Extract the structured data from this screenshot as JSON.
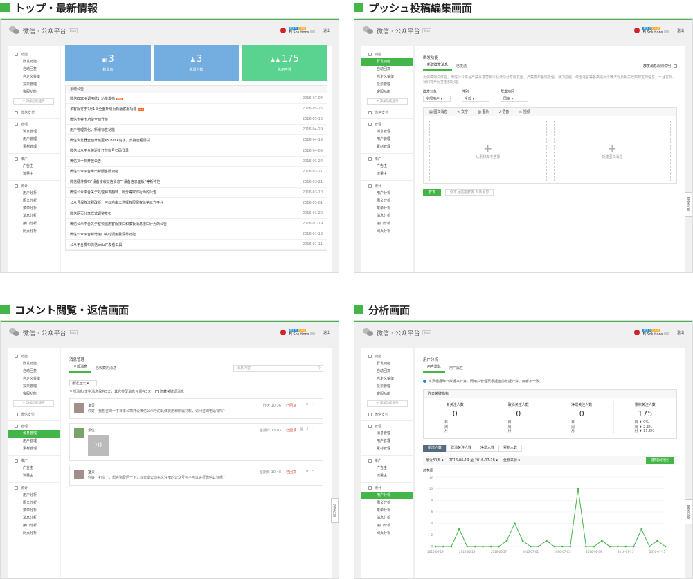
{
  "quads": {
    "q1": {
      "title": "トップ・最新情報"
    },
    "q2": {
      "title": "プッシュ投稿編集画面"
    },
    "q3": {
      "title": "コメント閲覧・返信画面"
    },
    "q4": {
      "title": "分析画面"
    }
  },
  "app": {
    "name": "微信 · 公众平台",
    "beta": "Beta",
    "account": "FJ Solutions",
    "badge_verified": "服务号",
    "badge_auth": "已认证",
    "logout": "退出",
    "feedback": "常见问题"
  },
  "sidebar": {
    "func_group": "功能",
    "func_items": [
      "群发功能",
      "自动回复",
      "自定义菜单",
      "投票管理",
      "客服功能"
    ],
    "add_plugin": "+ 添加功能插件",
    "pay": "微信支付",
    "manage_group": "管理",
    "manage_items": [
      "消息管理",
      "用户管理",
      "素材管理"
    ],
    "promo_group": "推广",
    "promo_items": [
      "广告主",
      "流量主"
    ],
    "stats_group": "统计",
    "stats_items": [
      "用户分析",
      "图文分析",
      "菜单分析",
      "消息分析",
      "接口分析",
      "网页分析"
    ]
  },
  "top": {
    "stats": [
      {
        "value": "3",
        "label": "新消息",
        "color": "#74aee0"
      },
      {
        "value": "3",
        "label": "新增人数",
        "color": "#74aee0"
      },
      {
        "value": "175",
        "label": "总用户数",
        "color": "#5ad290"
      }
    ],
    "notice_title": "系统公告",
    "notices": [
      {
        "title": "微信JSSDK调用统计功能发布",
        "date": "2016-07-04",
        "new": "NEW"
      },
      {
        "title": "多客服将于7月1日全面升级为新版客服功能",
        "date": "2016-05-26",
        "new": "NEW"
      },
      {
        "title": "微信卡券卡功能全面升级",
        "date": "2016-05-16",
        "new": ""
      },
      {
        "title": "用户管理优化，新增标签功能",
        "date": "2016-04-29",
        "new": ""
      },
      {
        "title": "微信浏览器全面升级至X5 Blink内核，支持远程调试",
        "date": "2016-04-19",
        "new": ""
      },
      {
        "title": "微信公众平台将逐步开放帐号扫码登录",
        "date": "2016-04-05",
        "new": ""
      },
      {
        "title": "微信扫一扫开放公告",
        "date": "2016-03-24",
        "new": ""
      },
      {
        "title": "微信公众平台推出新版客服功能",
        "date": "2016-03-21",
        "new": ""
      },
      {
        "title": "微信硬件发布“设备接收微信消息”“设备信息面板”等新特性",
        "date": "2016-03-21",
        "new": ""
      },
      {
        "title": "微信公众平台关于处理钟发翻转、刷分等欺诈行为的公告",
        "date": "2016-03-10",
        "new": ""
      },
      {
        "title": "公众号保权流程改版，可以自由义选择权限保权给第三方平台",
        "date": "2016-03-01",
        "new": ""
      },
      {
        "title": "微信网页分享样式调整发布",
        "date": "2016-01-20",
        "new": ""
      },
      {
        "title": "微信公众平台关于整顿滥用客服接口和模板消息接口行为的公告",
        "date": "2016-01-19",
        "new": ""
      },
      {
        "title": "微信公众平台新增接口实时调用量清零功能",
        "date": "2016-01-13",
        "new": ""
      },
      {
        "title": "公众平台发布微信web开发者工具",
        "date": "2016-01-11",
        "new": ""
      }
    ]
  },
  "push": {
    "page_title": "群发功能",
    "tabs": [
      "新建群发消息",
      "已发送"
    ],
    "rules_link": "群发消息规则说明",
    "desc": "为保障用户体验，微信公众平台严禁恶意营销以及诱导分享朋友圈，严禁发布色情低俗、暴力血腥、政治谣言等各类违反法律法规及相关政策规定的信息。一旦发现，我们将严厉打击和处理。",
    "fields": [
      {
        "label": "群发对象",
        "value": "全部用户"
      },
      {
        "label": "性别",
        "value": "全部"
      },
      {
        "label": "群发地区",
        "value": "国家"
      }
    ],
    "editor_tabs": [
      "图文消息",
      "文字",
      "图片",
      "语音",
      "视频"
    ],
    "box_left": "从素材库中选择",
    "box_right": "新建图文消息",
    "send_button": "群发",
    "remaining": "你本月还能群发 3 条消息"
  },
  "comment": {
    "page_title": "消息管理",
    "tabs": [
      "全部消息",
      "已收藏的消息"
    ],
    "search_placeholder": "消息内容",
    "range": "最近五天",
    "all_label": "全部消息(文字消息保存5天，其它类型消息只保存3天)",
    "hide_keyword": "隐藏关键词消息",
    "messages": [
      {
        "name": "室贝",
        "text": "你好，我想咨询一下日本公司开设微信公众号的具体费用和所需材料，请问咨询电话有吗？",
        "time": "昨天 10:36",
        "status": "已回复",
        "audio": false
      },
      {
        "name": "烦优",
        "text": "",
        "time": "星期六 13:03",
        "status": "已回复",
        "audio": true
      },
      {
        "name": "室贝",
        "text": "你好！初次了，想咨询费问一下，以日本公司名义注册的公众号可不可以进行微信认证呢？",
        "time": "星期日 10:48",
        "status": "已回复",
        "audio": false
      }
    ]
  },
  "analysis": {
    "page_title": "用户分析",
    "tabs": [
      "用户增长",
      "用户属性"
    ],
    "info": "本页根据昨日数据来计算，而用户管理页根据当前数据计算，两者不一致。",
    "key_title": "昨日关键指标",
    "kpis": [
      {
        "label": "新关注人数",
        "value": "0",
        "r1": "日 --",
        "r2": "周 --",
        "r3": "月 --"
      },
      {
        "label": "取消关注人数",
        "value": "0",
        "r1": "日 --",
        "r2": "周 --",
        "r3": "月 --"
      },
      {
        "label": "净增关注人数",
        "value": "0",
        "r1": "日 --",
        "r2": "周 --",
        "r3": "月 --"
      },
      {
        "label": "累积关注人数",
        "value": "175",
        "r1": "日 ♦ 0%",
        "r2": "周 ♦ 2.3%",
        "r3": "月 ♦ 11.5%"
      }
    ],
    "subtabs": [
      "新增人数",
      "取消关注人数",
      "净增人数",
      "累积人数"
    ],
    "range": "最近30天",
    "dates": "2016-06-19 至 2016-07-18",
    "source": "全部来源",
    "compare_button": "按时间对比",
    "trend_title": "趋势图"
  },
  "chart_data": {
    "type": "line",
    "title": "趋势图",
    "ylim": [
      0,
      12
    ],
    "yticks": [
      0,
      2,
      4,
      6,
      8,
      10,
      12
    ],
    "x": [
      "2016-06-19",
      "06-20",
      "06-21",
      "06-22",
      "2016-06-23",
      "06-24",
      "06-25",
      "06-26",
      "2016-06-27",
      "06-28",
      "06-29",
      "06-30",
      "2016-07-01",
      "07-02",
      "07-03",
      "07-04",
      "2016-07-05",
      "07-06",
      "07-07",
      "07-08",
      "2016-07-09",
      "07-10",
      "07-11",
      "07-12",
      "2016-07-13",
      "07-14",
      "07-15",
      "07-16",
      "2016-07-17",
      "07-18"
    ],
    "xticklabels": [
      "2016-06-19",
      "2016-06-23",
      "2016-06-27",
      "2016-07-01",
      "2016-07-05",
      "2016-07-09",
      "2016-07-13",
      "2016-07-17"
    ],
    "values": [
      0,
      0,
      0,
      3,
      0,
      0,
      0,
      0,
      0,
      1,
      4,
      1,
      0,
      0,
      1,
      0,
      0,
      0,
      10,
      0,
      0,
      1,
      0,
      0,
      0,
      0,
      3,
      0,
      1,
      0
    ],
    "color": "#44b549",
    "grid": true
  }
}
